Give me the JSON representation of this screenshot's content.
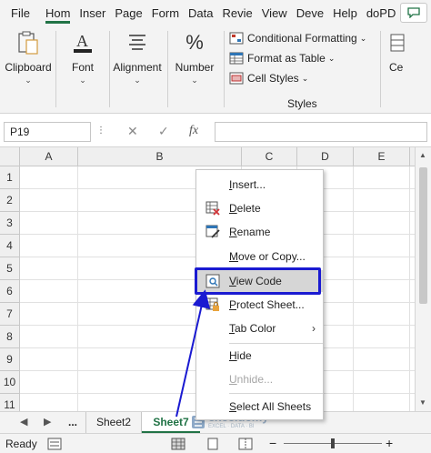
{
  "ribbon_tabs": [
    "File",
    "Hom",
    "Inser",
    "Page",
    "Form",
    "Data",
    "Revie",
    "View",
    "Deve",
    "Help",
    "doPD"
  ],
  "ribbon": {
    "clipboard": "Clipboard",
    "font": "Font",
    "alignment": "Alignment",
    "number": "Number",
    "conditional_formatting": "Conditional Formatting",
    "format_as_table": "Format as Table",
    "cell_styles": "Cell Styles",
    "styles_group": "Styles",
    "cells_partial": "Ce"
  },
  "formula_bar": {
    "name_box": "P19",
    "fx": "fx",
    "value": ""
  },
  "columns": [
    "A",
    "B",
    "C",
    "D",
    "E"
  ],
  "rows": [
    "1",
    "2",
    "3",
    "4",
    "5",
    "6",
    "7",
    "8",
    "9",
    "10",
    "11"
  ],
  "context_menu": {
    "insert": {
      "prefix": "",
      "key": "I",
      "rest": "nsert..."
    },
    "delete": {
      "prefix": "",
      "key": "D",
      "rest": "elete"
    },
    "rename": {
      "prefix": "",
      "key": "R",
      "rest": "ename"
    },
    "move_copy": {
      "prefix": "",
      "key": "M",
      "rest": "ove or Copy..."
    },
    "view_code": {
      "prefix": "",
      "key": "V",
      "rest": "iew Code"
    },
    "protect": {
      "prefix": "",
      "key": "P",
      "rest": "rotect Sheet..."
    },
    "tab_color": {
      "prefix": "",
      "key": "T",
      "rest": "ab Color"
    },
    "hide": {
      "prefix": "",
      "key": "H",
      "rest": "ide"
    },
    "unhide": {
      "prefix": "",
      "key": "U",
      "rest": "nhide..."
    },
    "select_all": {
      "prefix": "",
      "key": "S",
      "rest": "elect All Sheets"
    }
  },
  "sheet_tabs": {
    "ellipsis": "...",
    "sheet2": "Sheet2",
    "sheet7": "Sheet7"
  },
  "watermark": {
    "brand": "exceldemy",
    "tagline": "EXCEL · DATA · BI"
  },
  "status": {
    "ready": "Ready"
  },
  "colors": {
    "accent": "#217346",
    "callout": "#1a1ad1",
    "highlight": "#d6d6d6"
  }
}
